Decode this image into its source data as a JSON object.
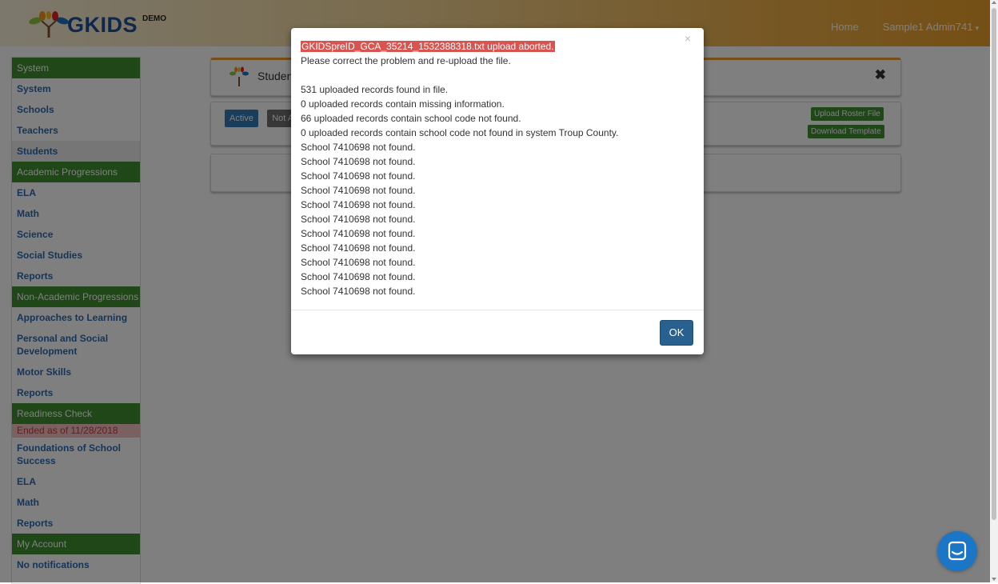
{
  "navbar": {
    "logo_text": "GKIDS",
    "logo_badge": "DEMO",
    "home_label": "Home",
    "user_label": "Sample1 Admin741"
  },
  "sidebar": {
    "system_header": "System",
    "system_items": [
      "System",
      "Schools",
      "Teachers",
      "Students"
    ],
    "academic_header": "Academic Progressions",
    "academic_items": [
      "ELA",
      "Math",
      "Science",
      "Social Studies",
      "Reports"
    ],
    "nonacademic_header": "Non-Academic Progressions",
    "nonacademic_items": [
      "Approaches to Learning",
      "Personal and Social Development",
      "Motor Skills",
      "Reports"
    ],
    "readiness_header": "Readiness Check",
    "readiness_notice": "Ended as of 11/28/2018",
    "readiness_items": [
      "Foundations of School Success",
      "ELA",
      "Math",
      "Reports"
    ],
    "account_header": "My Account",
    "account_items": [
      "No notifications"
    ]
  },
  "main": {
    "title": "Students",
    "active_label": "Active",
    "not_active_label": "Not Active",
    "upload_roster_label": "Upload Roster File",
    "download_template_label": "Download Template"
  },
  "modal": {
    "error_title": "GKIDSpreID_GCA_35214_1532388318.txt upload aborted.",
    "instruction": "Please correct the problem and re-upload the file.",
    "stats": [
      "531 uploaded records found in file.",
      "0 uploaded records contain missing information.",
      "66 uploaded records contain school code not found.",
      "0 uploaded records contain school code not found in system Troup County."
    ],
    "not_found_lines": [
      "School 7410698 not found.",
      "School 7410698 not found.",
      "School 7410698 not found.",
      "School 7410698 not found.",
      "School 7410698 not found.",
      "School 7410698 not found.",
      "School 7410698 not found.",
      "School 7410698 not found.",
      "School 7410698 not found.",
      "School 7410698 not found.",
      "School 7410698 not found."
    ],
    "close_symbol": "×",
    "ok_label": "OK"
  },
  "colors": {
    "accent_orange": "#ea9f2a",
    "section_green": "#3e8f2f",
    "link_blue": "#2d6ab3",
    "error_red": "#d9534f",
    "primary_button": "#286090",
    "chat_blue": "#1c76c6"
  }
}
